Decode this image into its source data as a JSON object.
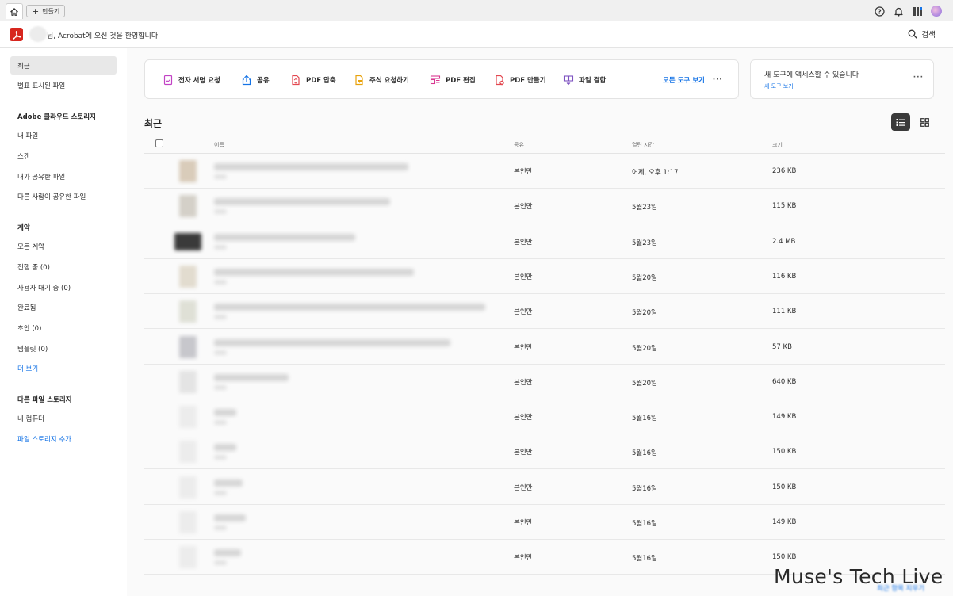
{
  "topbar": {
    "create_label": "만들기"
  },
  "header": {
    "welcome": "님, Acrobat에 오신 것을 환영합니다.",
    "search_label": "검색"
  },
  "sidebar": {
    "recent": "최근",
    "starred": "별표 표시된 파일",
    "cloud_heading": "Adobe 클라우드 스토리지",
    "cloud_items": [
      "내 파일",
      "스캔",
      "내가 공유한 파일",
      "다른 사람이 공유한 파일"
    ],
    "agreements_heading": "계약",
    "agreement_items": [
      "모든 계약",
      "진행 중 (0)",
      "사용자 대기 중 (0)",
      "완료됨",
      "초안 (0)",
      "템플릿 (0)"
    ],
    "more": "더 보기",
    "other_heading": "다른 파일 스토리지",
    "my_computer": "내 컴퓨터",
    "add_storage": "파일 스토리지 추가"
  },
  "tools": {
    "items": [
      {
        "label": "전자 서명 요청",
        "icon": "e-sign-icon",
        "color": "#c243c5"
      },
      {
        "label": "공유",
        "icon": "share-icon",
        "color": "#1473e6"
      },
      {
        "label": "PDF 압축",
        "icon": "compress-pdf-icon",
        "color": "#e34850"
      },
      {
        "label": "주석 요청하기",
        "icon": "comment-icon",
        "color": "#e8a20c"
      },
      {
        "label": "PDF 편집",
        "icon": "edit-pdf-icon",
        "color": "#d83790"
      },
      {
        "label": "PDF 만들기",
        "icon": "create-pdf-icon",
        "color": "#e34850"
      },
      {
        "label": "파일 결합",
        "icon": "combine-files-icon",
        "color": "#7e53c1"
      }
    ],
    "all_tools": "모든 도구 보기"
  },
  "news": {
    "title": "새 도구에 액세스할 수 있습니다",
    "link": "새 도구 보기"
  },
  "recent": {
    "title": "최근",
    "columns": {
      "name": "이름",
      "share": "공유",
      "opened": "열린 시간",
      "size": "크기"
    },
    "rows": [
      {
        "share": "본인만",
        "opened": "어제, 오후 1:17",
        "size": "236 KB"
      },
      {
        "share": "본인만",
        "opened": "5월23일",
        "size": "115 KB"
      },
      {
        "share": "본인만",
        "opened": "5월23일",
        "size": "2.4 MB"
      },
      {
        "share": "본인만",
        "opened": "5월20일",
        "size": "116 KB"
      },
      {
        "share": "본인만",
        "opened": "5월20일",
        "size": "111 KB"
      },
      {
        "share": "본인만",
        "opened": "5월20일",
        "size": "57 KB"
      },
      {
        "share": "본인만",
        "opened": "5월20일",
        "size": "640 KB"
      },
      {
        "share": "본인만",
        "opened": "5월16일",
        "size": "149 KB"
      },
      {
        "share": "본인만",
        "opened": "5월16일",
        "size": "150 KB"
      },
      {
        "share": "본인만",
        "opened": "5월16일",
        "size": "150 KB"
      },
      {
        "share": "본인만",
        "opened": "5월16일",
        "size": "149 KB"
      },
      {
        "share": "본인만",
        "opened": "5월16일",
        "size": "150 KB"
      }
    ],
    "footer_link": "최근 항목 지우기"
  },
  "watermark": "Muse's Tech Live"
}
